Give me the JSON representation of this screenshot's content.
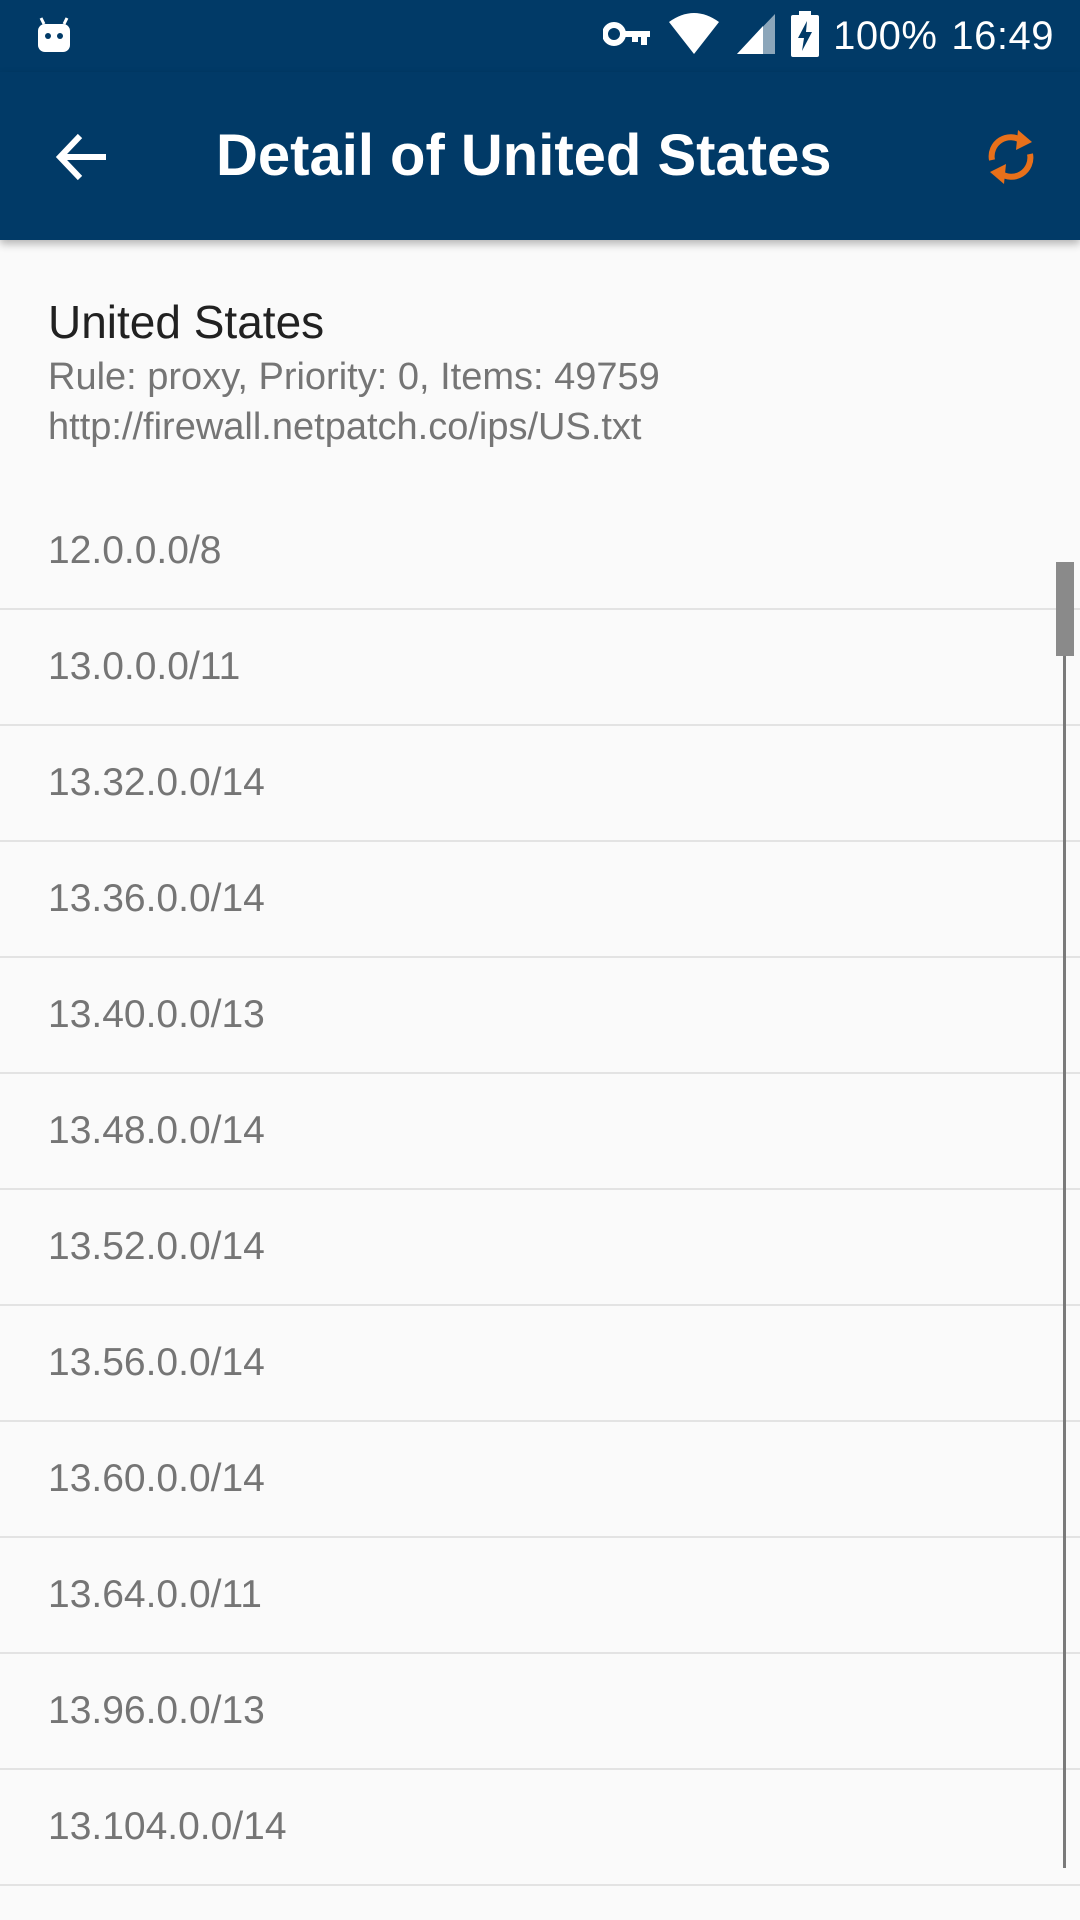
{
  "status_bar": {
    "notification_icon": "android-robot-icon",
    "vpn_icon": "key-icon",
    "wifi_icon": "wifi-icon",
    "signal_icon": "cell-signal-icon",
    "battery_icon": "battery-charging-icon",
    "battery_text": "100%",
    "time": "16:49"
  },
  "app_bar": {
    "title": "Detail of United States",
    "back_icon": "arrow-left-icon",
    "refresh_icon": "refresh-icon",
    "background_color": "#013a67",
    "accent_color": "#e8701a"
  },
  "header": {
    "country": "United States",
    "rule_line": "Rule: proxy, Priority: 0, Items: 49759",
    "url": "http://firewall.netpatch.co/ips/US.txt"
  },
  "ip_ranges": [
    "12.0.0.0/8",
    "13.0.0.0/11",
    "13.32.0.0/14",
    "13.36.0.0/14",
    "13.40.0.0/13",
    "13.48.0.0/14",
    "13.52.0.0/14",
    "13.56.0.0/14",
    "13.60.0.0/14",
    "13.64.0.0/11",
    "13.96.0.0/13",
    "13.104.0.0/14"
  ]
}
